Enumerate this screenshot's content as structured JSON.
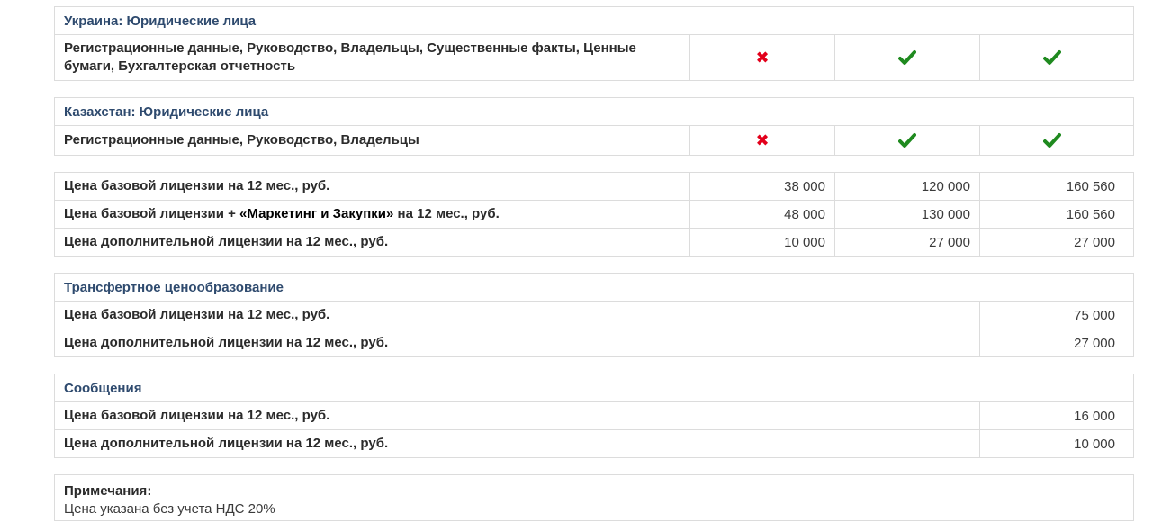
{
  "ukraine": {
    "title": "Украина: Юридические лица",
    "row": {
      "label": "Регистрационные данные, Руководство, Владельцы, Существенные факты, Ценные бумаги, Бухгалтерская отчетность",
      "marks": [
        "cross",
        "check",
        "check"
      ]
    }
  },
  "kazakhstan": {
    "title": "Казахстан: Юридические лица",
    "row": {
      "label": "Регистрационные данные, Руководство, Владельцы",
      "marks": [
        "cross",
        "check",
        "check"
      ]
    }
  },
  "prices": {
    "rows": [
      {
        "label": "Цена базовой лицензии на 12 мес., руб.",
        "values": [
          "38 000",
          "120 000",
          "160 560"
        ]
      },
      {
        "label_pre": "Цена базовой лицензии + ",
        "label_em": "«Маркетинг и Закупки»",
        "label_post": " на 12 мес., руб.",
        "values": [
          "48 000",
          "130 000",
          "160 560"
        ]
      },
      {
        "label": "Цена дополнительной лицензии на 12 мес., руб.",
        "values": [
          "10 000",
          "27 000",
          "27 000"
        ]
      }
    ]
  },
  "transfer": {
    "title": "Трансфертное ценообразование",
    "rows": [
      {
        "label": "Цена базовой лицензии на 12 мес., руб.",
        "value": "75 000"
      },
      {
        "label": "Цена дополнительной лицензии на 12 мес., руб.",
        "value": "27 000"
      }
    ]
  },
  "messages": {
    "title": "Сообщения",
    "rows": [
      {
        "label": "Цена базовой лицензии на 12 мес., руб.",
        "value": "16 000"
      },
      {
        "label": "Цена дополнительной лицензии на 12 мес., руб.",
        "value": "10 000"
      }
    ]
  },
  "notes": {
    "title": "Примечания:",
    "text": "Цена указана без учета НДС 20%"
  },
  "colors": {
    "cross": "#e3001b",
    "check": "#1f8a1f",
    "heading": "#2e4a6e",
    "border": "#dcdcdc"
  },
  "icons": {
    "cross": "cross-icon",
    "check": "check-icon"
  }
}
